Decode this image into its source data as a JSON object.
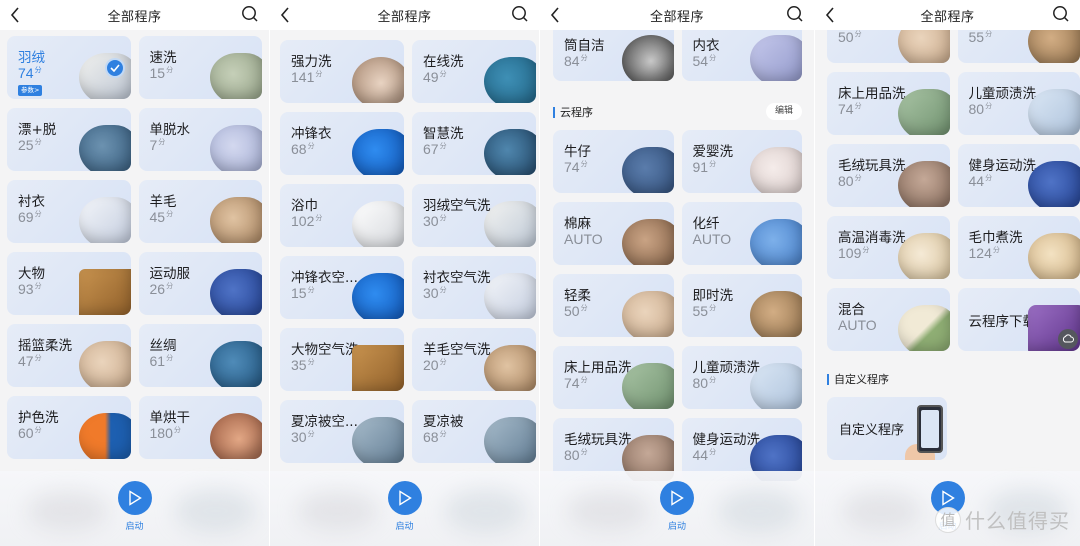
{
  "app": {
    "title": "全部程序",
    "accent_color": "#2f80e0",
    "start_label": "启动",
    "back_icon": "chevron-left-icon",
    "search_icon": "search-icon"
  },
  "screen1": {
    "cards": [
      {
        "name": "羽绒",
        "time": "74",
        "unit": "分",
        "selected": true,
        "params_label": "参数>"
      },
      {
        "name": "速洗",
        "time": "15",
        "unit": "分"
      },
      {
        "name": "漂+脱",
        "time": "25",
        "unit": "分"
      },
      {
        "name": "单脱水",
        "time": "7",
        "unit": "分"
      },
      {
        "name": "衬衣",
        "time": "69",
        "unit": "分"
      },
      {
        "name": "羊毛",
        "time": "45",
        "unit": "分"
      },
      {
        "name": "大物",
        "time": "93",
        "unit": "分"
      },
      {
        "name": "运动服",
        "time": "26",
        "unit": "分"
      },
      {
        "name": "摇篮柔洗",
        "time": "47",
        "unit": "分"
      },
      {
        "name": "丝绸",
        "time": "61",
        "unit": "分"
      },
      {
        "name": "护色洗",
        "time": "60",
        "unit": "分"
      },
      {
        "name": "单烘干",
        "time": "180",
        "unit": "分"
      }
    ]
  },
  "screen2": {
    "cards": [
      {
        "name": "强力洗",
        "time": "141",
        "unit": "分"
      },
      {
        "name": "在线洗",
        "time": "49",
        "unit": "分"
      },
      {
        "name": "冲锋衣",
        "time": "68",
        "unit": "分"
      },
      {
        "name": "智慧洗",
        "time": "67",
        "unit": "分"
      },
      {
        "name": "浴巾",
        "time": "102",
        "unit": "分"
      },
      {
        "name": "羽绒空气洗",
        "time": "30",
        "unit": "分"
      },
      {
        "name": "冲锋衣空...",
        "time": "15",
        "unit": "分"
      },
      {
        "name": "衬衣空气洗",
        "time": "30",
        "unit": "分"
      },
      {
        "name": "大物空气洗",
        "time": "35",
        "unit": "分"
      },
      {
        "name": "羊毛空气洗",
        "time": "20",
        "unit": "分"
      },
      {
        "name": "夏凉被空...",
        "time": "30",
        "unit": "分"
      },
      {
        "name": "夏凉被",
        "time": "68",
        "unit": "分"
      }
    ]
  },
  "screen3": {
    "top_cards": [
      {
        "name": "筒自洁",
        "time": "84",
        "unit": "分"
      },
      {
        "name": "内衣",
        "time": "54",
        "unit": "分"
      }
    ],
    "cloud_section": {
      "label": "云程序",
      "edit_label": "编辑"
    },
    "cloud_cards": [
      {
        "name": "牛仔",
        "time": "74",
        "unit": "分"
      },
      {
        "name": "爱婴洗",
        "time": "91",
        "unit": "分"
      },
      {
        "name": "棉麻",
        "time": "AUTO",
        "unit": ""
      },
      {
        "name": "化纤",
        "time": "AUTO",
        "unit": ""
      },
      {
        "name": "轻柔",
        "time": "50",
        "unit": "分"
      },
      {
        "name": "即时洗",
        "time": "55",
        "unit": "分"
      },
      {
        "name": "床上用品洗",
        "time": "74",
        "unit": "分"
      },
      {
        "name": "儿童顽渍洗",
        "time": "80",
        "unit": "分"
      },
      {
        "name": "毛绒玩具洗",
        "time": "80",
        "unit": "分"
      },
      {
        "name": "健身运动洗",
        "time": "44",
        "unit": "分"
      }
    ]
  },
  "screen4": {
    "cards": [
      {
        "name": "",
        "time": "50",
        "unit": "分"
      },
      {
        "name": "",
        "time": "55",
        "unit": "分"
      },
      {
        "name": "床上用品洗",
        "time": "74",
        "unit": "分"
      },
      {
        "name": "儿童顽渍洗",
        "time": "80",
        "unit": "分"
      },
      {
        "name": "毛绒玩具洗",
        "time": "80",
        "unit": "分"
      },
      {
        "name": "健身运动洗",
        "time": "44",
        "unit": "分"
      },
      {
        "name": "高温消毒洗",
        "time": "109",
        "unit": "分"
      },
      {
        "name": "毛巾煮洗",
        "time": "124",
        "unit": "分"
      },
      {
        "name": "混合",
        "time": "AUTO",
        "unit": ""
      },
      {
        "name": "云程序下载",
        "time": "",
        "unit": ""
      }
    ],
    "custom_section": {
      "label": "自定义程序"
    },
    "custom_card": {
      "name": "自定义程序"
    }
  },
  "watermark": {
    "circle": "值",
    "text": "什么值得买"
  }
}
